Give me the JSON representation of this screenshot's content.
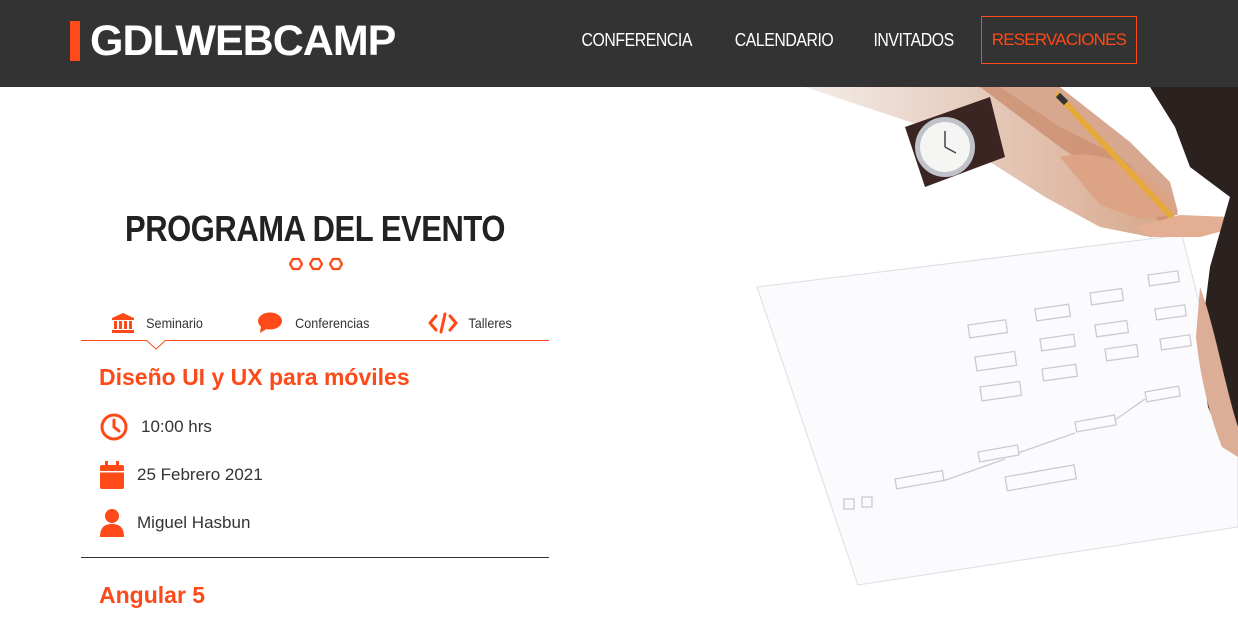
{
  "header": {
    "logo": "GDLWEBCAMP",
    "nav": [
      "CONFERENCIA",
      "CALENDARIO",
      "INVITADOS"
    ],
    "cta": "RESERVACIONES"
  },
  "program": {
    "title": "PROGRAMA DEL EVENTO",
    "tabs": [
      {
        "label": "Seminario",
        "icon": "bank-icon"
      },
      {
        "label": "Conferencias",
        "icon": "comment-icon"
      },
      {
        "label": "Talleres",
        "icon": "code-icon"
      }
    ],
    "sessions": [
      {
        "title": "Diseño UI y UX para móviles",
        "time": "10:00 hrs",
        "date": "25 Febrero 2021",
        "speaker": "Miguel Hasbun"
      },
      {
        "title": "Angular 5"
      }
    ]
  },
  "colors": {
    "accent": "#fe4918",
    "header_bg": "#333333"
  }
}
